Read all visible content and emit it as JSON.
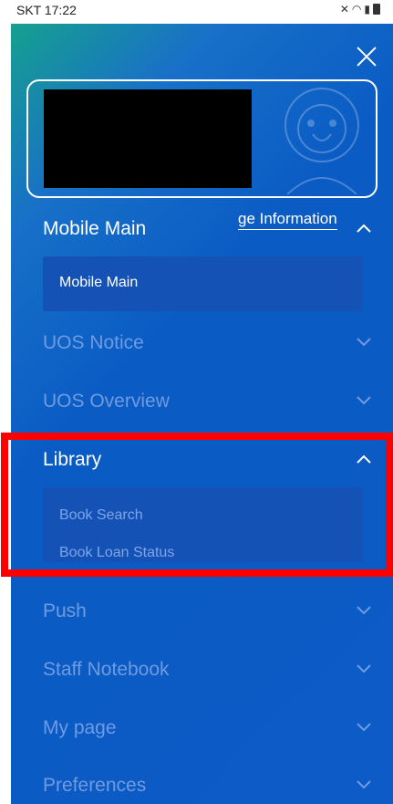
{
  "status": {
    "carrier_time": "SKT 17:22"
  },
  "profile": {
    "link_label": "ge Information"
  },
  "menu": [
    {
      "label": "Mobile Main",
      "expanded": true,
      "subitems": [
        "Mobile Main"
      ]
    },
    {
      "label": "UOS Notice",
      "expanded": false
    },
    {
      "label": "UOS Overview",
      "expanded": false
    },
    {
      "label": "Library",
      "expanded": true,
      "subitems": [
        "Book Search",
        "Book Loan Status"
      ]
    },
    {
      "label": "Push",
      "expanded": false
    },
    {
      "label": "Staff Notebook",
      "expanded": false
    },
    {
      "label": "My page",
      "expanded": false
    },
    {
      "label": "Preferences",
      "expanded": false
    }
  ],
  "colors": {
    "drawer_bg": "#0d5bc6",
    "highlight": "#ff0000"
  }
}
